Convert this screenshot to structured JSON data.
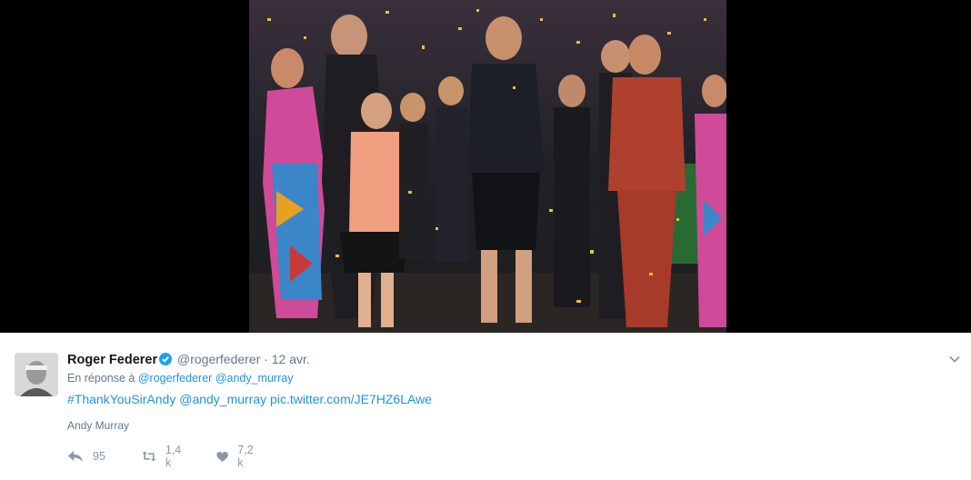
{
  "tweet": {
    "author_name": "Roger Federer",
    "author_handle": "@rogerfederer",
    "separator": "·",
    "timestamp": "12 avr.",
    "reply_prefix": "En réponse à",
    "reply_to": [
      "@rogerfederer",
      "@andy_murray"
    ],
    "hashtag": "#ThankYouSirAndy",
    "mention": "@andy_murray",
    "pic_link": "pic.twitter.com/JE7HZ6LAwe",
    "quoted_label": "Andy Murray",
    "verified": true
  },
  "actions": {
    "reply": {
      "icon": "reply-icon",
      "count": "95"
    },
    "retweet": {
      "icon": "retweet-icon",
      "count": "1,4 k"
    },
    "like": {
      "icon": "heart-icon",
      "count": "7,2 k"
    }
  },
  "menu": {
    "icon": "chevron-down-icon"
  },
  "colors": {
    "link": "#1b95e0",
    "text": "#14171a",
    "muted": "#657786",
    "action_gray": "#8899a6",
    "verified_badge": "#1da1f2"
  }
}
